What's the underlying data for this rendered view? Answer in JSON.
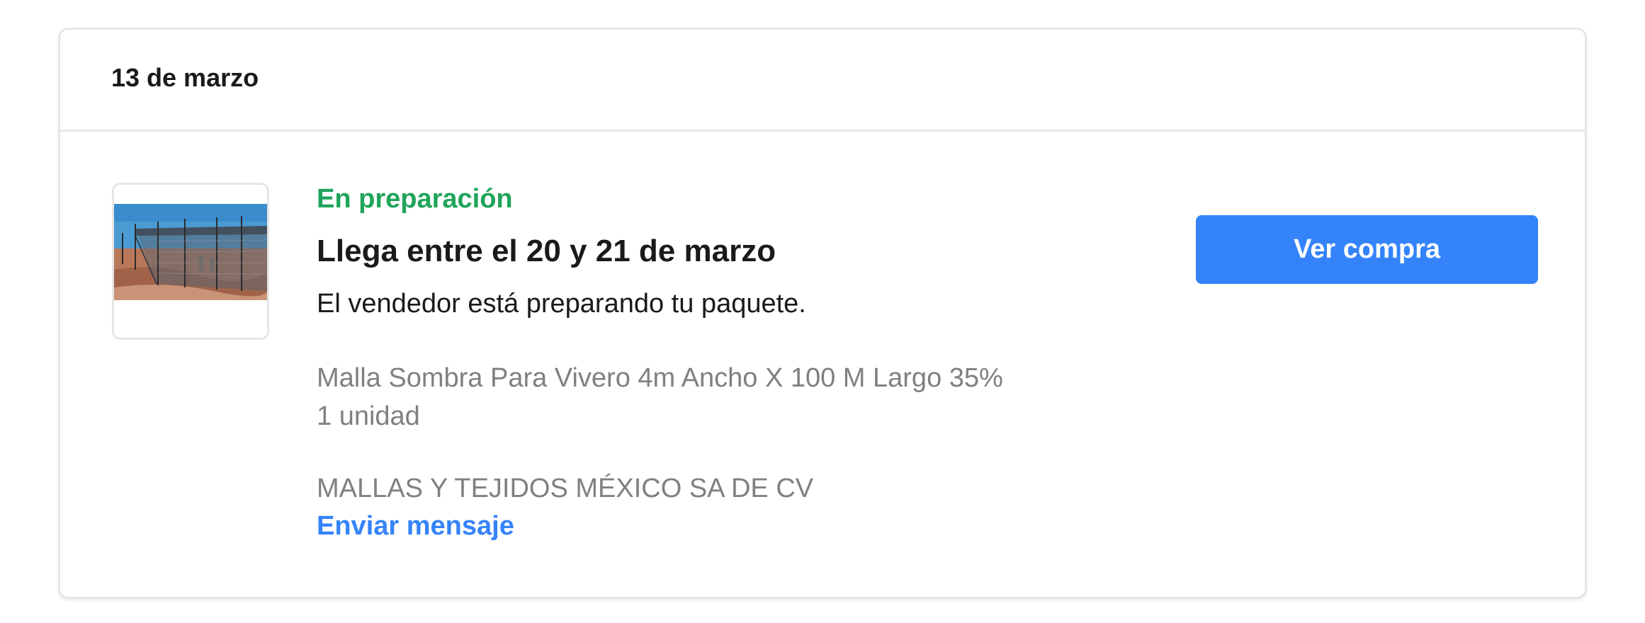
{
  "purchase": {
    "date": "13 de marzo",
    "status": "En preparación",
    "status_color": "#1fa45a",
    "arrival": "Llega entre el 20 y 21 de marzo",
    "description": "El vendedor está preparando tu paquete.",
    "product_title": "Malla Sombra Para Vivero 4m Ancho X 100 M Largo 35%",
    "quantity": "1 unidad",
    "seller": "MALLAS Y TEJIDOS MÉXICO SA DE CV",
    "message_link": "Enviar mensaje",
    "view_button": "Ver compra",
    "product_image_icon": "shade-net-greenhouse-photo",
    "accent_color": "#3483fa"
  }
}
